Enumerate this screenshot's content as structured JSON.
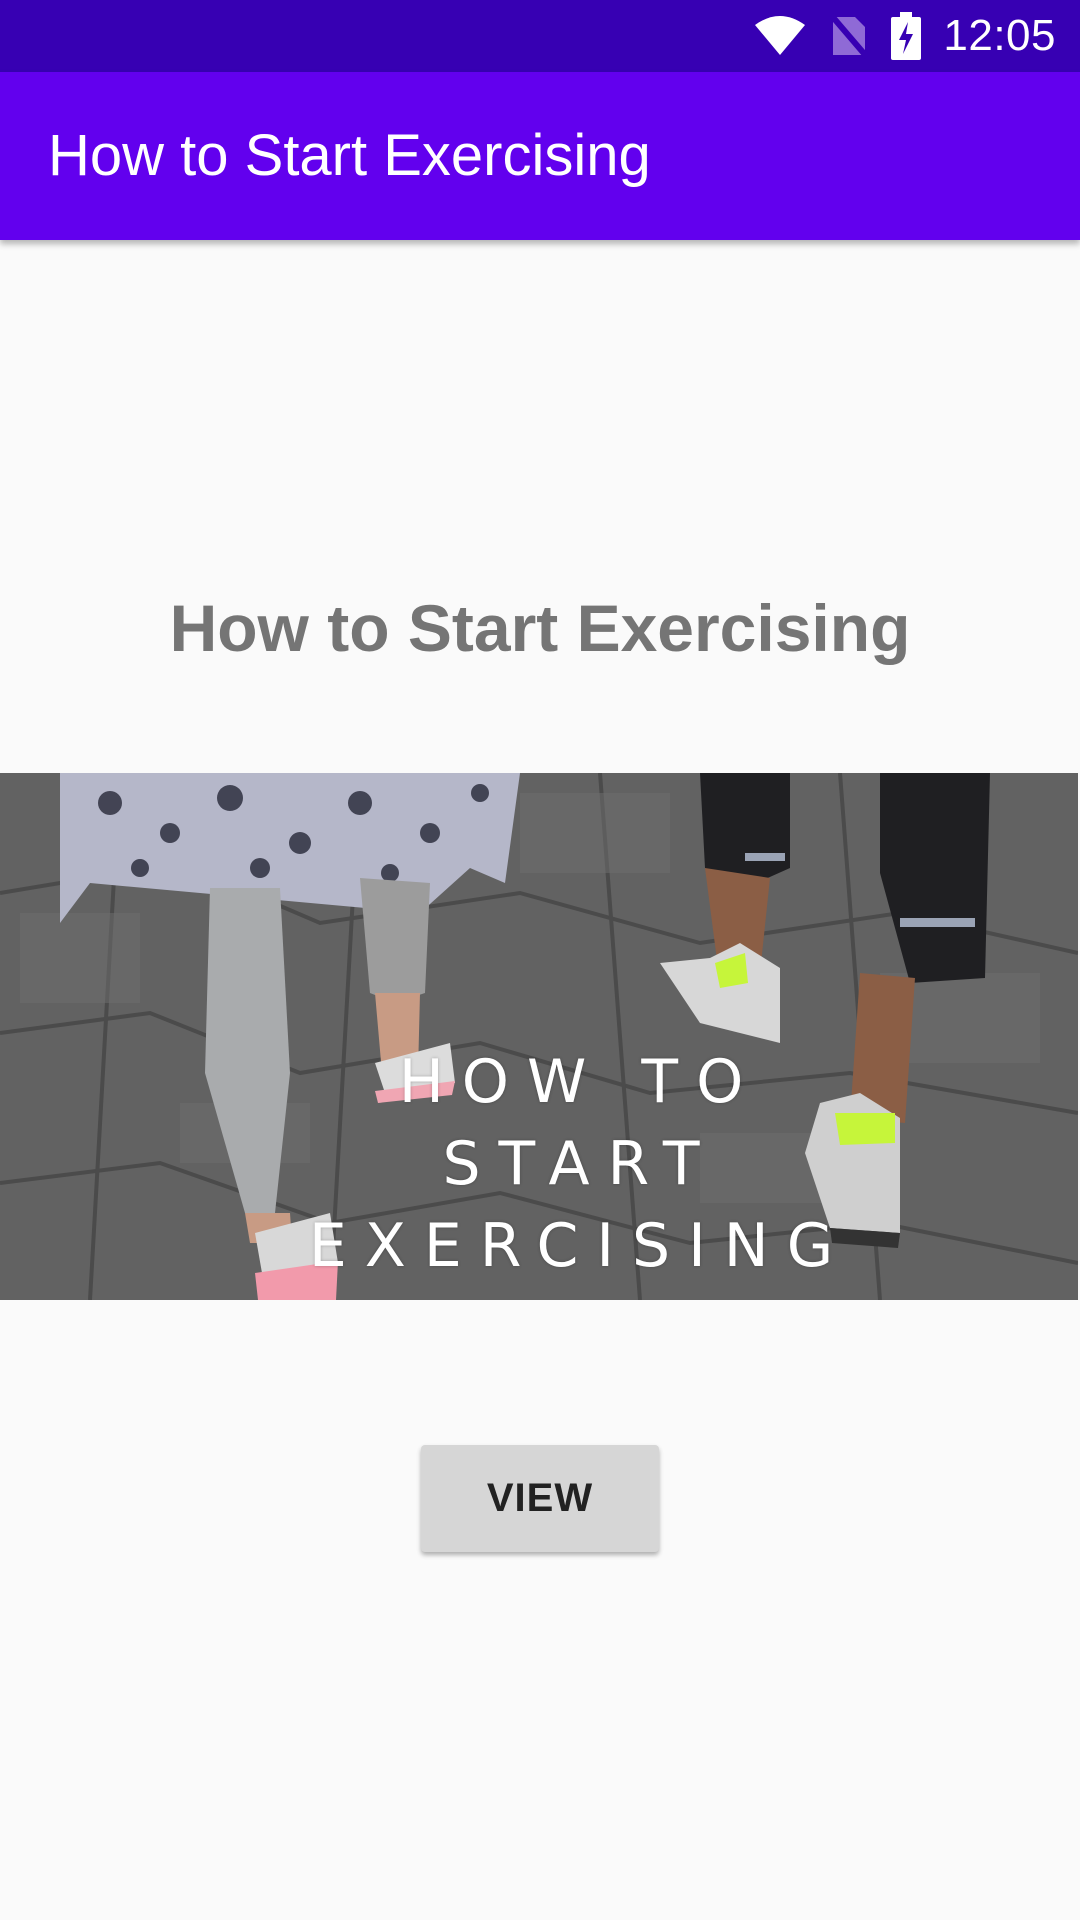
{
  "status_bar": {
    "time": "12:05",
    "icons": [
      "wifi-icon",
      "no-sim-icon",
      "battery-charging-icon"
    ],
    "background": "#3700b3"
  },
  "app_bar": {
    "title": "How to Start Exercising",
    "background": "#6200ee"
  },
  "main": {
    "heading": "How to Start Exercising",
    "hero_image": {
      "caption_lines": [
        "HOW TO",
        "START",
        "EXERCISING"
      ]
    },
    "view_button_label": "VIEW"
  }
}
